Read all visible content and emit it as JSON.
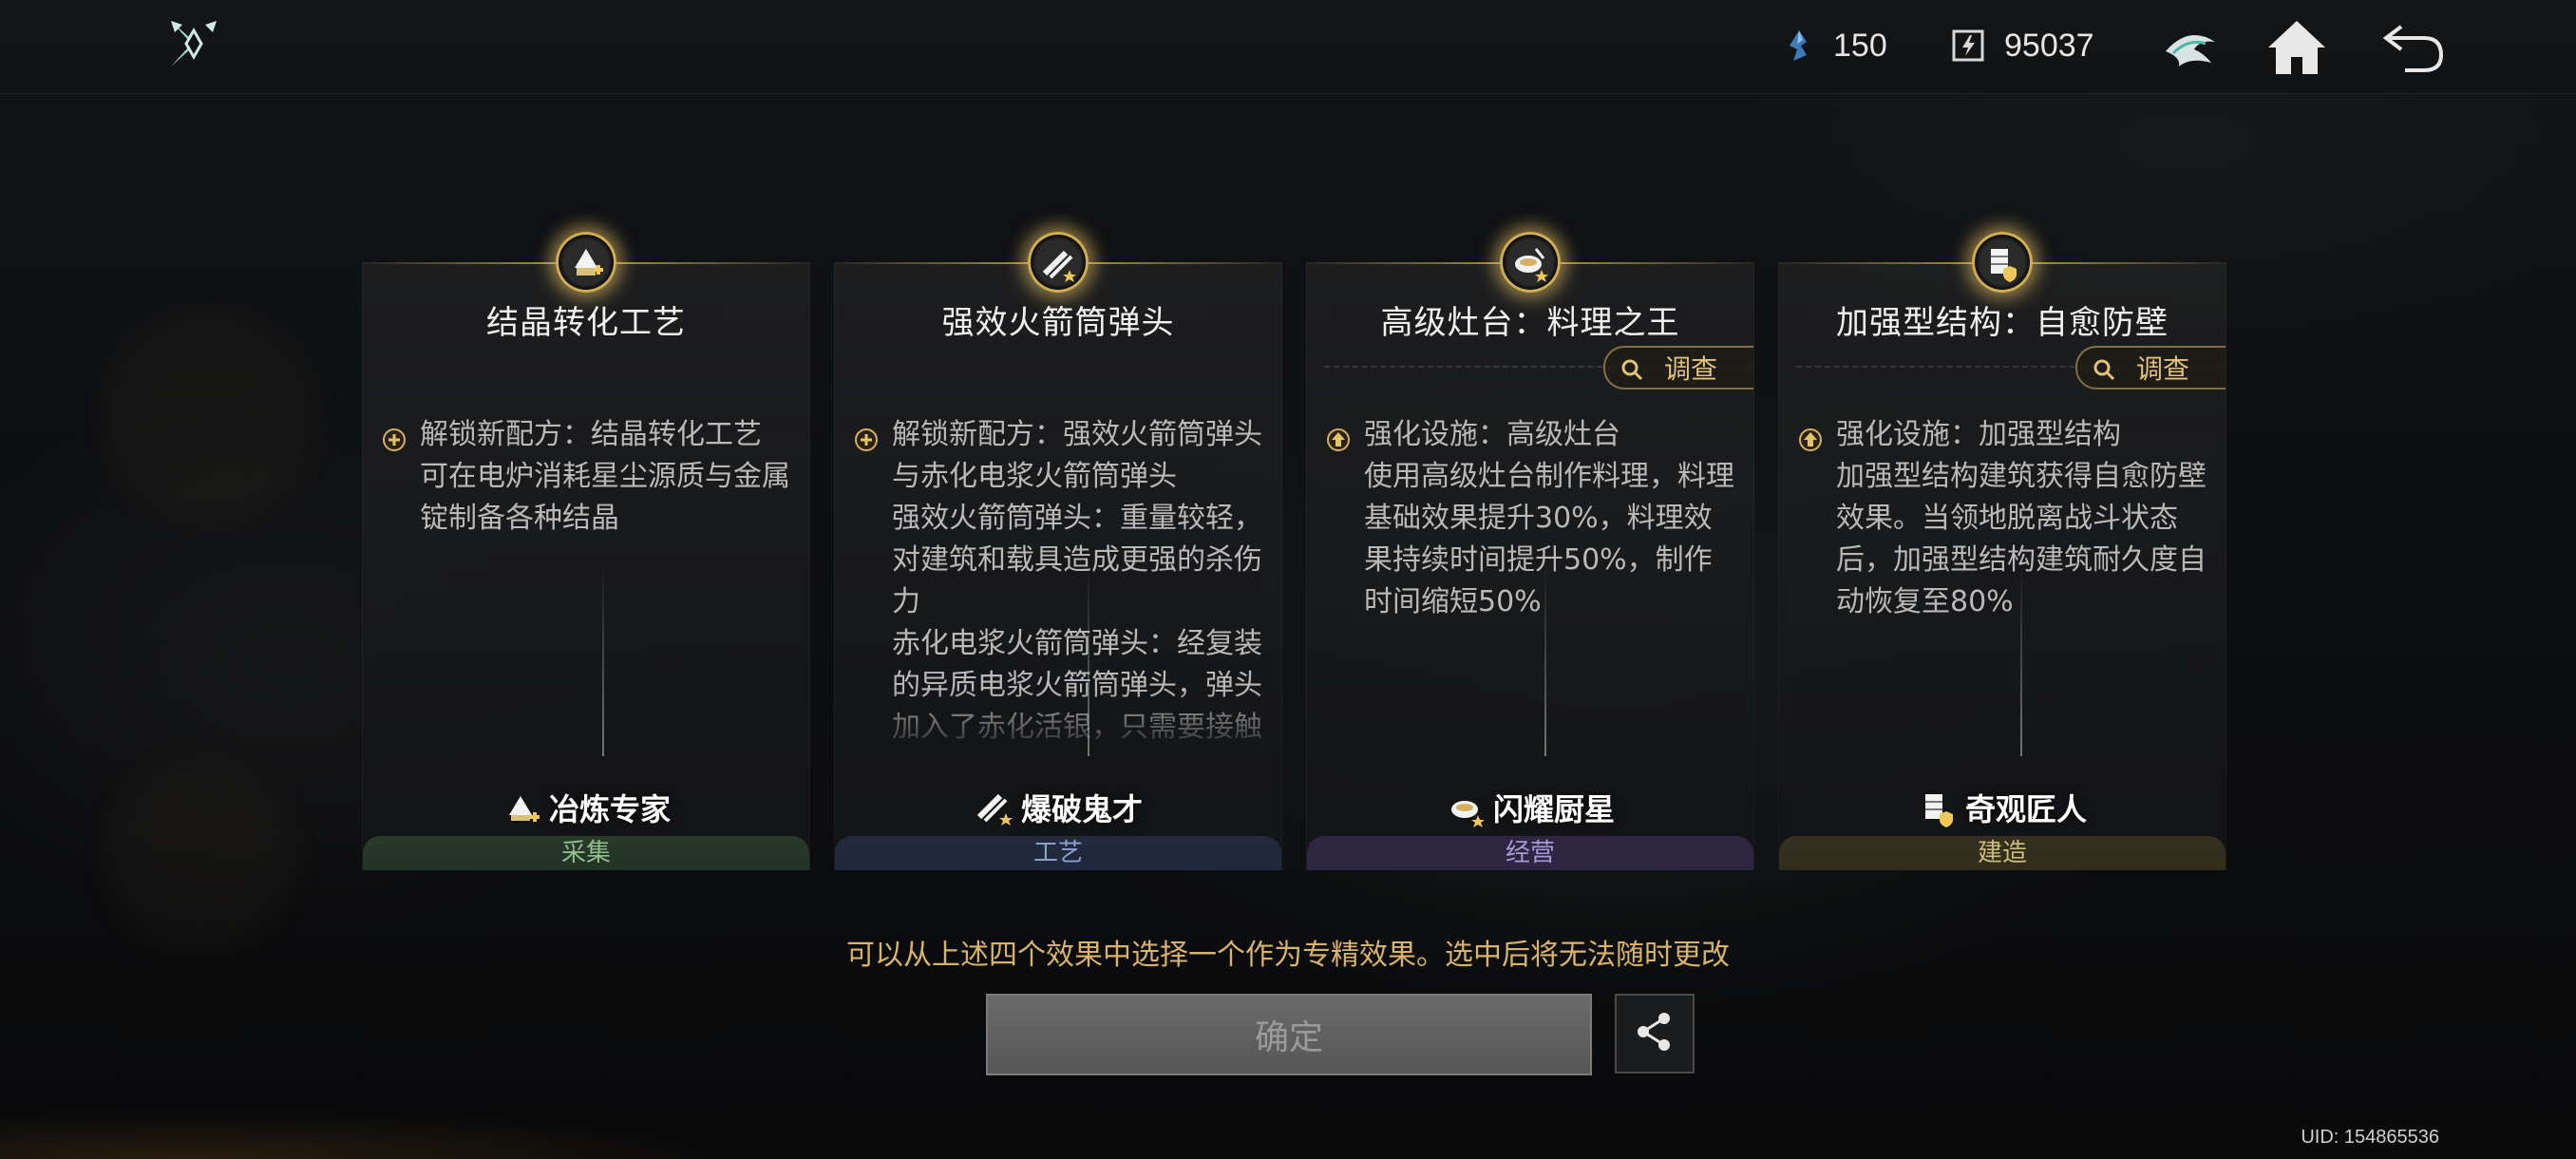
{
  "topbar": {
    "crystal_count": "150",
    "coin_count": "95037",
    "icons": [
      "shuriken-logo-icon",
      "crystal-icon",
      "coin-icon",
      "emblem-icon",
      "home-icon",
      "back-icon"
    ]
  },
  "cards": [
    {
      "title": "结晶转化工艺",
      "has_investigate": false,
      "desc_icon": "plus",
      "desc_lines": [
        "解锁新配方：结晶转化工艺",
        "可在电炉消耗星尘源质与金属锭制备各种结晶"
      ],
      "role": "冶炼专家",
      "category": "采集",
      "category_color": "#8fbf8a"
    },
    {
      "title": "强效火箭筒弹头",
      "has_investigate": false,
      "desc_icon": "plus",
      "desc_lines": [
        "解锁新配方：强效火箭筒弹头与赤化电浆火箭筒弹头",
        "强效火箭筒弹头：重量较轻，对建筑和载具造成更强的杀伤力",
        "赤化电浆火箭筒弹头：经复装的异质电浆火箭筒弹头，弹头加入了赤化活银，只需要接触就能引发小规模的爆"
      ],
      "role": "爆破鬼才",
      "category": "工艺",
      "category_color": "#8aa0cf"
    },
    {
      "title": "高级灶台：料理之王",
      "has_investigate": true,
      "investigate_label": "调查",
      "desc_icon": "up",
      "desc_lines": [
        "强化设施：高级灶台",
        "使用高级灶台制作料理，料理基础效果提升30%，料理效果持续时间提升50%，制作时间缩短50%"
      ],
      "role": "闪耀厨星",
      "category": "经营",
      "category_color": "#a999d4"
    },
    {
      "title": "加强型结构：自愈防壁",
      "has_investigate": true,
      "investigate_label": "调查",
      "desc_icon": "up",
      "desc_lines": [
        "强化设施：加强型结构",
        "加强型结构建筑获得自愈防壁效果。当领地脱离战斗状态后，加强型结构建筑耐久度自动恢复至80%"
      ],
      "role": "奇观匠人",
      "category": "建造",
      "category_color": "#cdbb7b"
    }
  ],
  "hint": "可以从上述四个效果中选择一个作为专精效果。选中后将无法随时更改",
  "confirm_label": "确定",
  "uid": "UID: 154865536"
}
